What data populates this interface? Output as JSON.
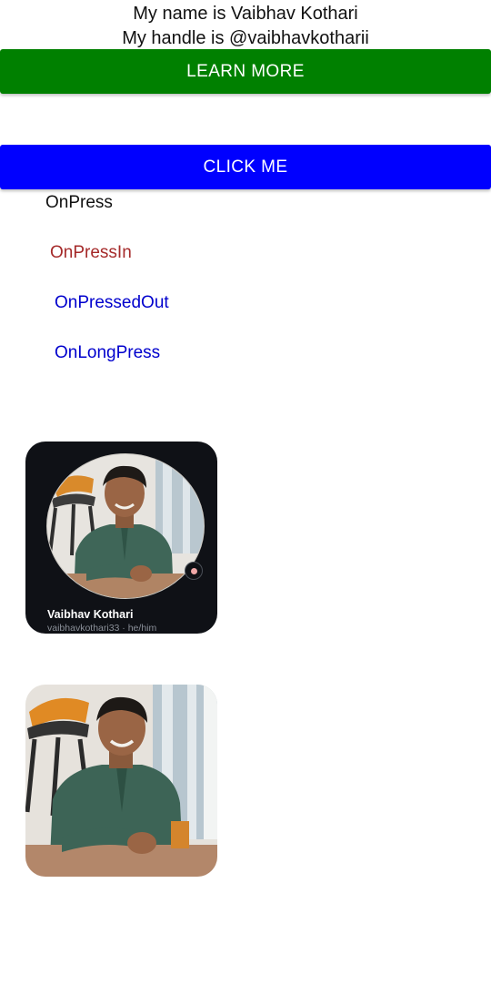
{
  "intro": {
    "name_line": "My name is Vaibhav Kothari",
    "handle_line": "My handle is @vaibhavkotharii"
  },
  "buttons": {
    "learn_more": "LEARN MORE",
    "click_me": "CLICK ME"
  },
  "press_events": [
    "OnPress",
    "OnPressIn",
    "OnPressedOut",
    "OnLongPress"
  ],
  "profile_card": {
    "name": "Vaibhav Kothari",
    "handle": "vaibhavkothari33 · he/him"
  },
  "colors": {
    "learn_more_bg": "#008000",
    "click_me_bg": "#0000ff",
    "on_press_in": "#a52a2a",
    "on_pressed_out": "#0000cd",
    "card_bg": "#0f1116"
  }
}
